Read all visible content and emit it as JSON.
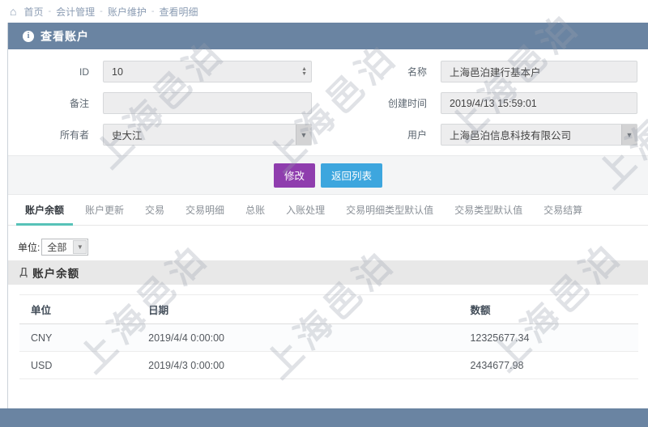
{
  "breadcrumb": {
    "home": "首页",
    "separator": "-",
    "items": [
      "会计管理",
      "账户维护",
      "查看明细"
    ]
  },
  "panel": {
    "title": "查看账户"
  },
  "form": {
    "fields": [
      {
        "label": "ID",
        "value": "10"
      },
      {
        "label": "名称",
        "value": "上海邑泊建行基本户"
      },
      {
        "label": "备注",
        "value": ""
      },
      {
        "label": "创建时间",
        "value": "2019/4/13 15:59:01"
      },
      {
        "label": "所有者",
        "value": "史大江"
      },
      {
        "label": "用户",
        "value": "上海邑泊信息科技有限公司"
      }
    ]
  },
  "actions": {
    "edit_label": "修改",
    "back_label": "返回列表"
  },
  "tabs": [
    {
      "label": "账户余额",
      "active": true
    },
    {
      "label": "账户更新",
      "active": false
    },
    {
      "label": "交易",
      "active": false
    },
    {
      "label": "交易明细",
      "active": false
    },
    {
      "label": "总账",
      "active": false
    },
    {
      "label": "入账处理",
      "active": false
    },
    {
      "label": "交易明细类型默认值",
      "active": false
    },
    {
      "label": "交易类型默认值",
      "active": false
    },
    {
      "label": "交易结算",
      "active": false
    }
  ],
  "filter": {
    "label": "单位:",
    "value": "全部"
  },
  "section": {
    "title": "账户余额"
  },
  "table": {
    "columns": [
      "单位",
      "日期",
      "数额"
    ],
    "rows": [
      [
        "CNY",
        "2019/4/4 0:00:00",
        "12325677.34"
      ],
      [
        "USD",
        "2019/4/3 0:00:00",
        "2434677.98"
      ]
    ]
  },
  "watermark": {
    "text": "上海邑泊"
  },
  "colors": {
    "header_bar": "#6a84a2",
    "edit_button": "#8f3dae",
    "back_button": "#3da6de",
    "active_tab_underline": "#57c2b8"
  }
}
